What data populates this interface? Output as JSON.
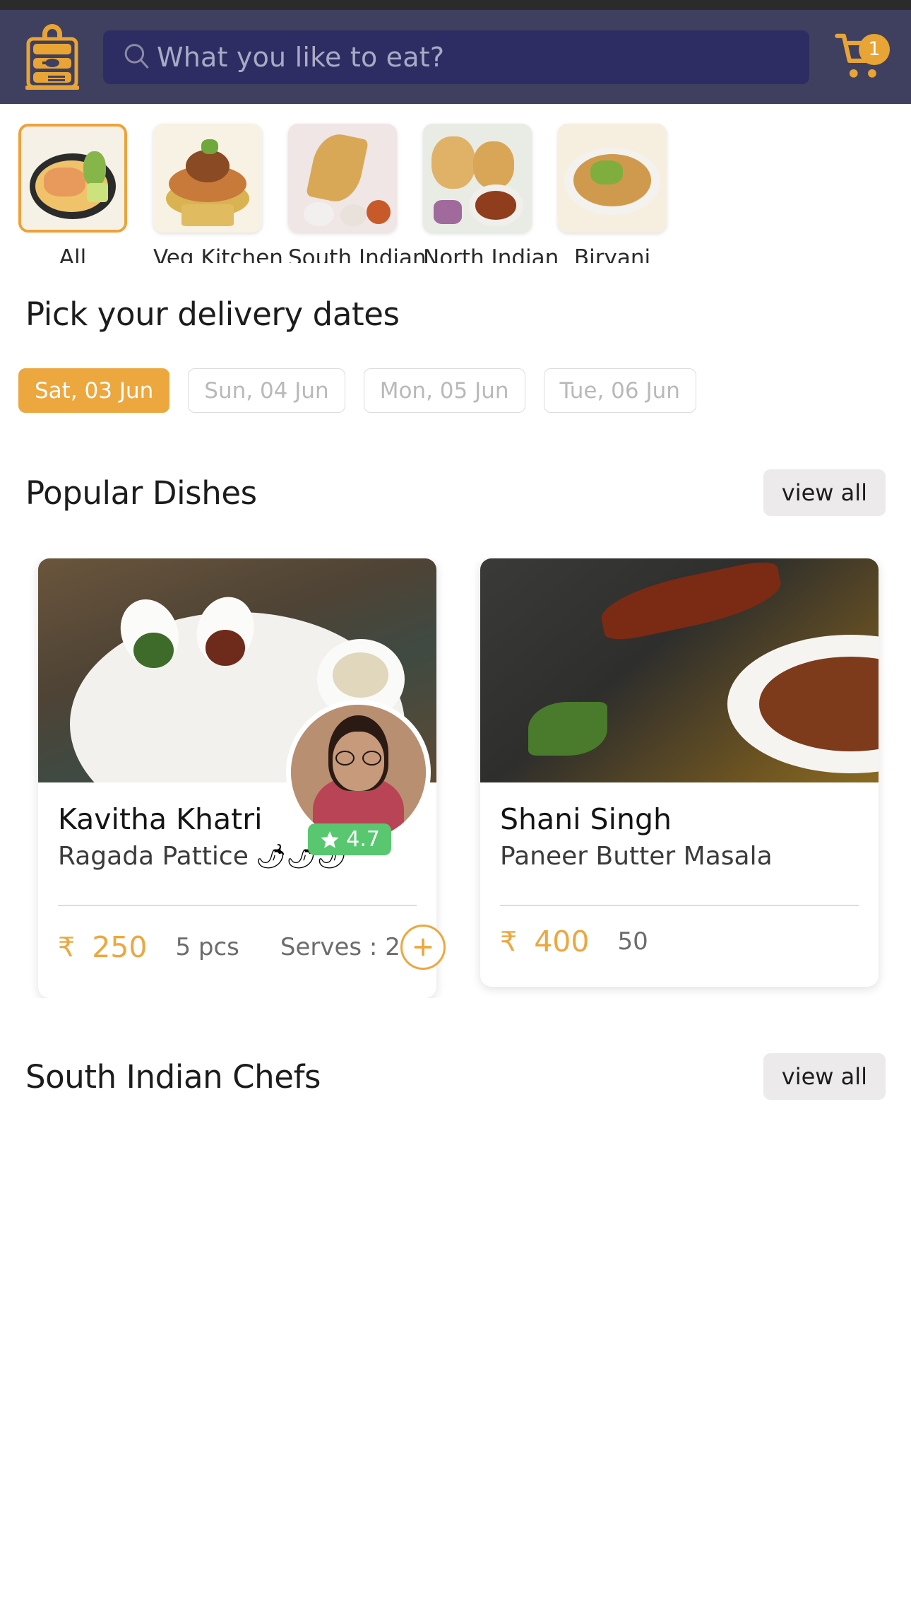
{
  "header": {
    "logo_icon": "tiffin-box-icon",
    "search_icon": "search-icon",
    "search_placeholder": "What you like to eat?",
    "search_value": "",
    "cart_icon": "shopping-cart-icon",
    "cart_badge_count": "1",
    "bg_color": "#3f3f5f",
    "accent_color": "#e8a535"
  },
  "categories": [
    {
      "label": "All",
      "selected": true
    },
    {
      "label": "Veg Kitchen",
      "selected": false
    },
    {
      "label": "South Indian",
      "selected": false
    },
    {
      "label": "North Indian",
      "selected": false
    },
    {
      "label": "Biryani",
      "selected": false
    }
  ],
  "delivery": {
    "title": "Pick your delivery dates",
    "dates": [
      {
        "label": "Sat, 03 Jun",
        "selected": true
      },
      {
        "label": "Sun, 04 Jun",
        "selected": false
      },
      {
        "label": "Mon, 05 Jun",
        "selected": false
      },
      {
        "label": "Tue, 06 Jun",
        "selected": false
      }
    ]
  },
  "popular": {
    "title": "Popular Dishes",
    "view_all_label": "view all",
    "cards": [
      {
        "chef": "Kavitha Khatri",
        "dish": "Ragada Pattice",
        "spice": "🌶🌶🌶",
        "rating": "4.7",
        "rating_icon": "star-icon",
        "currency": "₹",
        "price": "250",
        "pieces": "5 pcs",
        "serves": "Serves : 2",
        "add_icon": "plus-circle-icon"
      },
      {
        "chef": "Shani Singh",
        "dish": "Paneer Butter Masala",
        "spice": "",
        "rating": "",
        "rating_icon": "star-icon",
        "currency": "₹",
        "price": "400",
        "pieces": "50",
        "serves": "",
        "add_icon": "plus-circle-icon"
      }
    ]
  },
  "south_indian": {
    "title": "South Indian Chefs",
    "view_all_label": "view all"
  },
  "colors": {
    "accent_orange": "#eda73f",
    "header_navy": "#3f3f5f",
    "search_navy": "#2d2d63",
    "rating_green": "#58c770",
    "muted_text": "#6c6c6c"
  }
}
